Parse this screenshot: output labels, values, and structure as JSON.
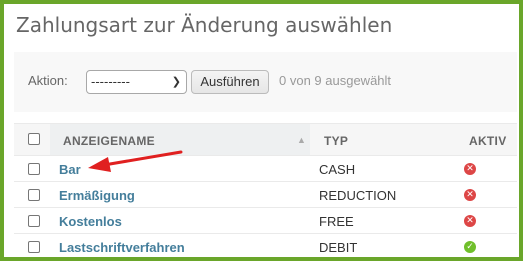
{
  "page": {
    "title": "Zahlungsart zur Änderung auswählen"
  },
  "actions": {
    "label": "Aktion:",
    "select_value": "---------",
    "run_label": "Ausführen",
    "counter": "0 von 9 ausgewählt"
  },
  "table": {
    "columns": [
      "ANZEIGENAME",
      "TYP",
      "AKTIV"
    ],
    "sorted_column": "ANZEIGENAME",
    "rows": [
      {
        "name": "Bar",
        "type": "CASH",
        "active": false
      },
      {
        "name": "Ermäßigung",
        "type": "REDUCTION",
        "active": false
      },
      {
        "name": "Kostenlos",
        "type": "FREE",
        "active": false
      },
      {
        "name": "Lastschriftverfahren",
        "type": "DEBIT",
        "active": true
      }
    ]
  },
  "colors": {
    "frame_border": "#6aa62a",
    "link": "#447e9b",
    "inactive_icon": "#dd4646",
    "active_icon": "#70bf2b",
    "annotation_arrow": "#e02020"
  },
  "icons": {
    "inactive": "x-circle-icon",
    "active": "check-circle-icon",
    "sort": "sort-ascending-icon",
    "select": "chevron-down-icon"
  }
}
